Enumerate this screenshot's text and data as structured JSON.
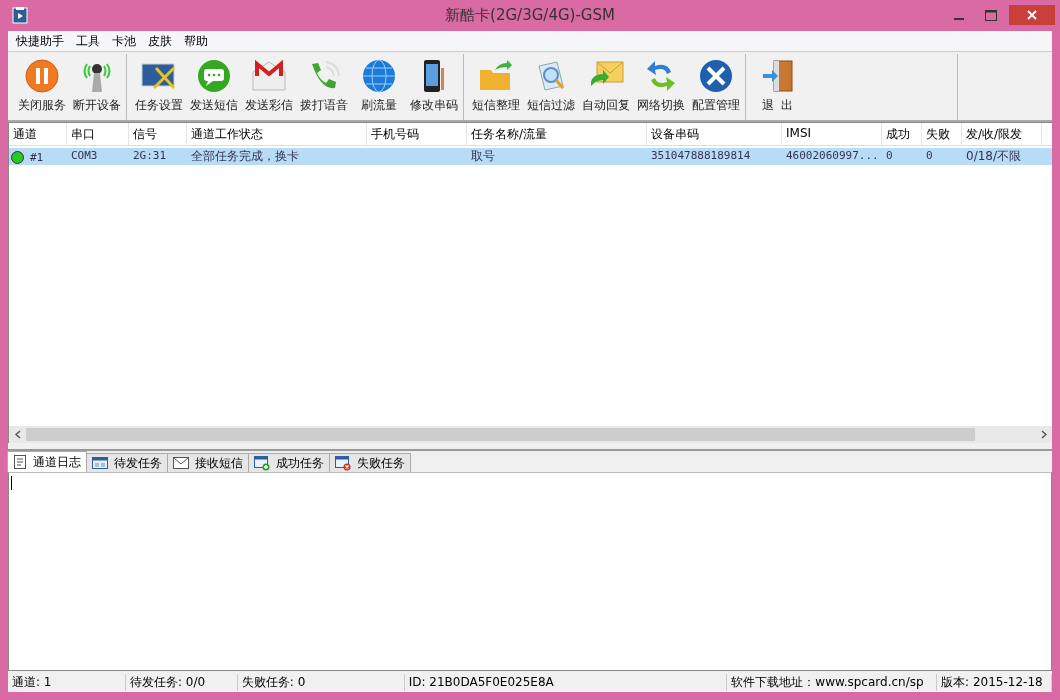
{
  "window": {
    "title": "新酷卡(2G/3G/4G)-GSM"
  },
  "menu": [
    "快捷助手",
    "工具",
    "卡池",
    "皮肤",
    "帮助"
  ],
  "toolbar": [
    [
      {
        "label": "关闭服务",
        "kind": "pause"
      },
      {
        "label": "断开设备",
        "kind": "antenna"
      }
    ],
    [
      {
        "label": "任务设置",
        "kind": "screen-tools"
      },
      {
        "label": "发送短信",
        "kind": "chat"
      },
      {
        "label": "发送彩信",
        "kind": "mail"
      },
      {
        "label": "拨打语音",
        "kind": "call"
      },
      {
        "label": "刷流量",
        "kind": "globe"
      },
      {
        "label": "修改串码",
        "kind": "phone"
      }
    ],
    [
      {
        "label": "短信整理",
        "kind": "folder"
      },
      {
        "label": "短信过滤",
        "kind": "filter"
      },
      {
        "label": "自动回复",
        "kind": "reply"
      },
      {
        "label": "网络切换",
        "kind": "swap"
      },
      {
        "label": "配置管理",
        "kind": "tools"
      }
    ],
    [
      {
        "label": "退  出",
        "kind": "exit"
      }
    ]
  ],
  "table": {
    "columns": [
      "通道",
      "串口",
      "信号",
      "通道工作状态",
      "手机号码",
      "任务名称/流量",
      "设备串码",
      "IMSI",
      "成功",
      "失败",
      "发/收/限发"
    ],
    "rows": [
      {
        "color": "#22cc22",
        "selected": true,
        "cells": [
          "#1",
          "COM3",
          "2G:31",
          "全部任务完成，换卡",
          "",
          "取号",
          "351047888189814",
          "46002060997...",
          "0",
          "0",
          "0/18/不限"
        ]
      }
    ]
  },
  "tabs": [
    {
      "label": "通道日志",
      "kind": "log",
      "selected": true
    },
    {
      "label": "待发任务",
      "kind": "pending",
      "selected": false
    },
    {
      "label": "接收短信",
      "kind": "inbox",
      "selected": false
    },
    {
      "label": "成功任务",
      "kind": "success",
      "selected": false
    },
    {
      "label": "失败任务",
      "kind": "fail",
      "selected": false
    }
  ],
  "status_bar": [
    "通道: 1",
    "待发任务: 0/0",
    "失败任务: 0",
    "ID: 21B0DA5F0E025E8A",
    "软件下载地址：www.spcard.cn/sp",
    "版本: 2015-12-18"
  ]
}
